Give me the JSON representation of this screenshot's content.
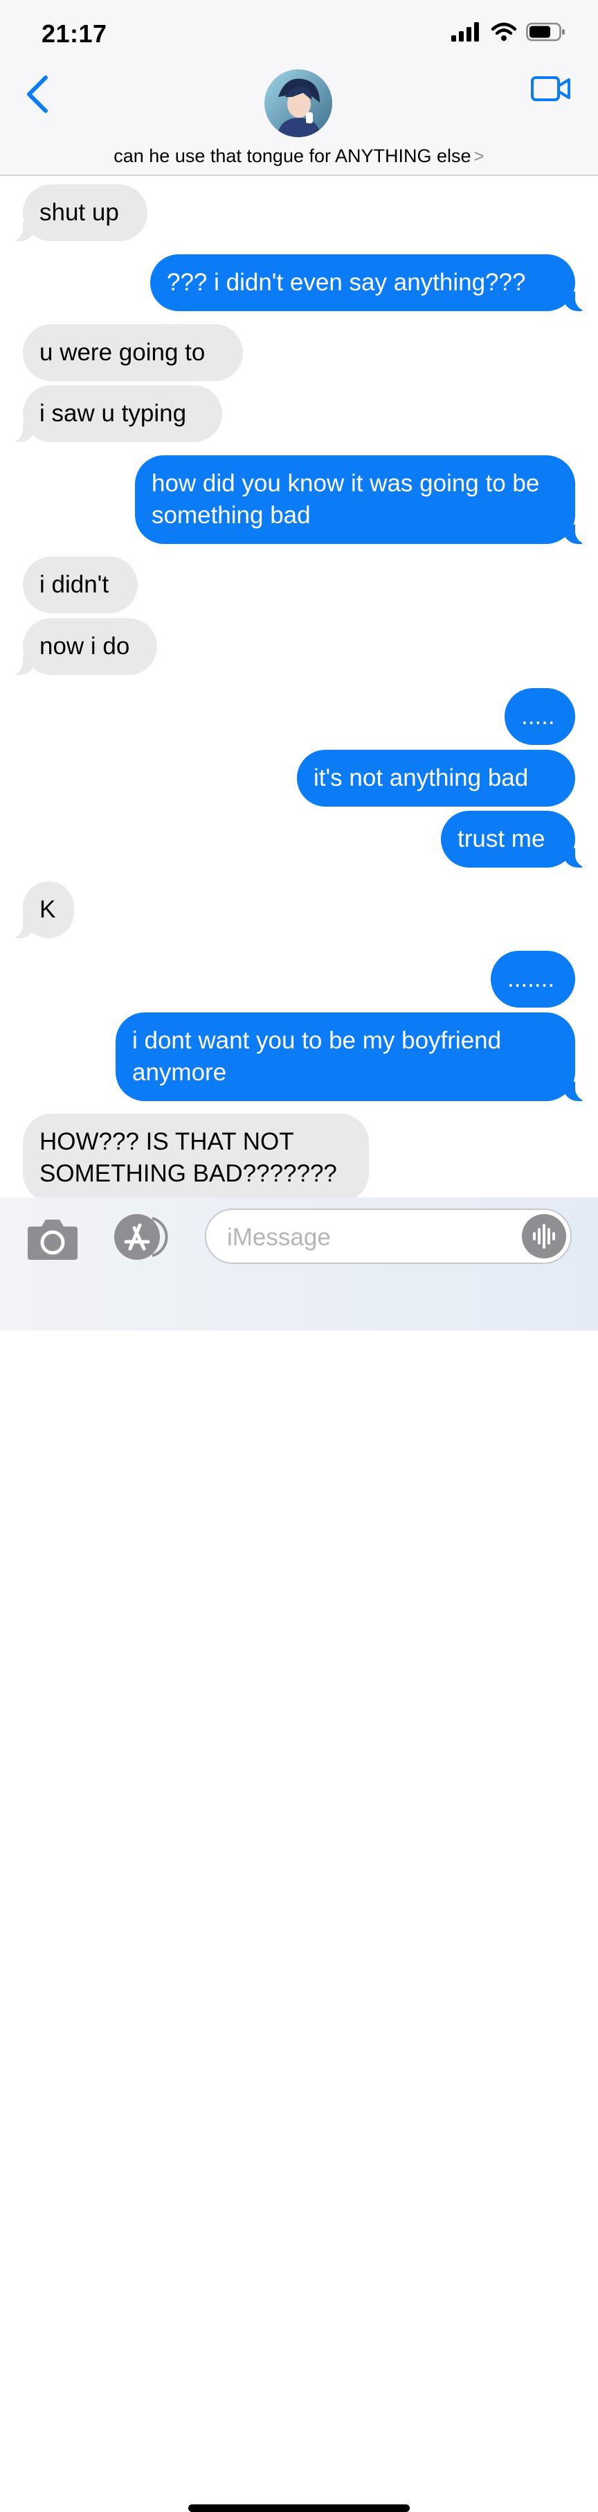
{
  "status": {
    "time": "21:17"
  },
  "header": {
    "contact_name": "can he use that tongue for ANYTHING else",
    "chevron": ">"
  },
  "messages": [
    {
      "from": "them",
      "text": "shut up"
    },
    {
      "from": "me",
      "text": "??? i didn't even say anything???"
    },
    {
      "from": "them",
      "text": "u were going to"
    },
    {
      "from": "them",
      "text": "i saw u typing"
    },
    {
      "from": "me",
      "text": "how did you know it was going to be something bad"
    },
    {
      "from": "them",
      "text": "i didn't"
    },
    {
      "from": "them",
      "text": "now i do"
    },
    {
      "from": "me",
      "text": "....."
    },
    {
      "from": "me",
      "text": "it's not anything bad"
    },
    {
      "from": "me",
      "text": "trust me"
    },
    {
      "from": "them",
      "text": "K"
    },
    {
      "from": "me",
      "text": "......."
    },
    {
      "from": "me",
      "text": "i dont want you to be my boyfriend anymore"
    },
    {
      "from": "them",
      "text": "HOW??? IS THAT NOT SOMETHING BAD???????"
    }
  ],
  "composer": {
    "placeholder": "iMessage"
  },
  "colors": {
    "accent": "#0b7cf6",
    "incoming": "#e9e9eb"
  }
}
